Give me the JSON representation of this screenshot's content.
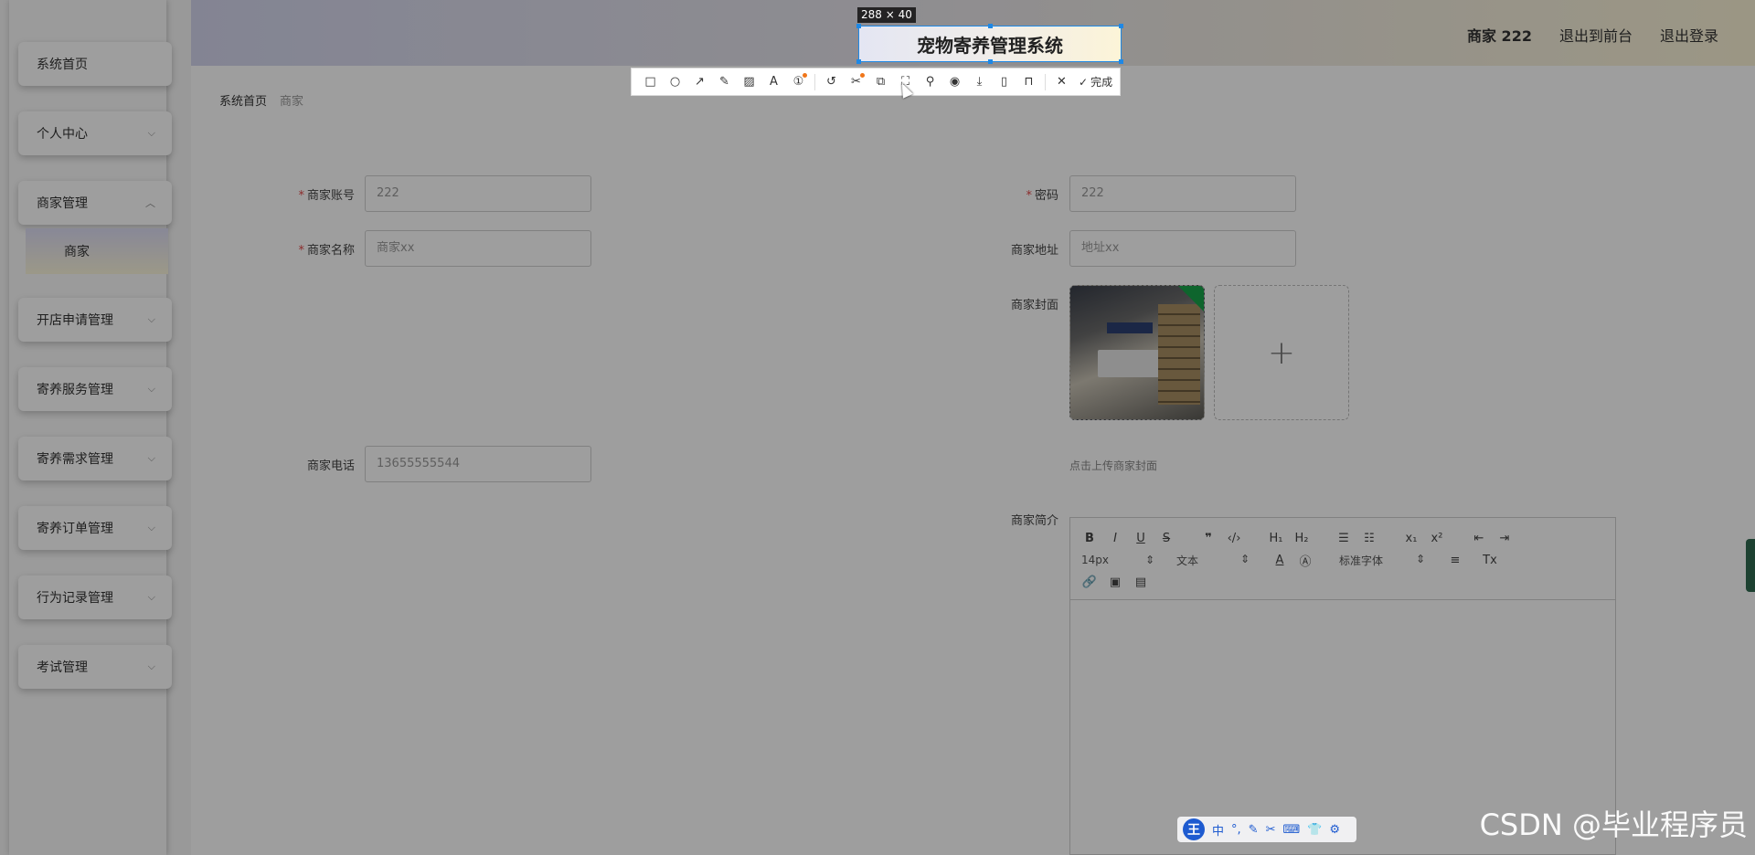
{
  "app": {
    "title": "宠物寄养管理系统"
  },
  "header": {
    "user_label": "商家 222",
    "to_front_label": "退出到前台",
    "logout_label": "退出登录"
  },
  "sidebar": {
    "items": [
      {
        "label": "系统首页"
      },
      {
        "label": "个人中心"
      },
      {
        "label": "商家管理"
      },
      {
        "label": "开店申请管理"
      },
      {
        "label": "寄养服务管理"
      },
      {
        "label": "寄养需求管理"
      },
      {
        "label": "寄养订单管理"
      },
      {
        "label": "行为记录管理"
      },
      {
        "label": "考试管理"
      }
    ],
    "sub_item": {
      "label": "商家"
    }
  },
  "breadcrumb": {
    "home": "系统首页",
    "current": "商家"
  },
  "form": {
    "account": {
      "label": "商家账号",
      "value": "222"
    },
    "password": {
      "label": "密码",
      "value": "222"
    },
    "name": {
      "label": "商家名称",
      "placeholder": "商家xx"
    },
    "address": {
      "label": "商家地址",
      "placeholder": "地址xx"
    },
    "cover": {
      "label": "商家封面",
      "hint": "点击上传商家封面"
    },
    "phone": {
      "label": "商家电话",
      "value": "13655555544"
    },
    "intro": {
      "label": "商家简介"
    }
  },
  "editor": {
    "font_size": "14px",
    "block_type": "文本",
    "font_family": "标准字体"
  },
  "snip": {
    "size_label": "288 × 40",
    "done_label": "完成"
  },
  "ime": {
    "logo": "王",
    "mode": "中"
  },
  "watermark": "CSDN @毕业程序员"
}
